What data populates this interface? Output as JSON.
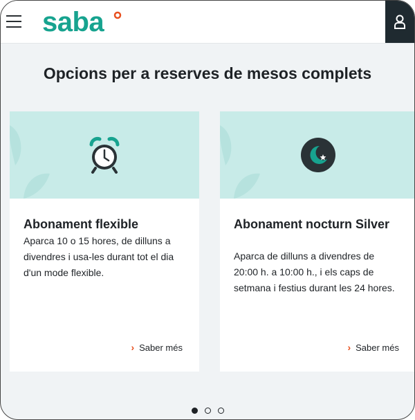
{
  "header": {
    "logo_text": "saba",
    "brand_color": "#17a38f",
    "accent_color": "#e8501f",
    "menu_icon": "hamburger-icon",
    "account_icon": "user-icon"
  },
  "page": {
    "title": "Opcions per a reserves de mesos complets"
  },
  "cards": [
    {
      "icon": "alarm-clock-icon",
      "title": "Abonament flexible",
      "description": "Aparca 10 o 15 hores, de dilluns a divendres i usa-les durant tot el dia d'un mode flexible.",
      "link_label": "Saber més"
    },
    {
      "icon": "moon-star-icon",
      "title": "Abonament nocturn Silver",
      "description": "Aparca de dilluns a divendres de 20:00 h. a 10:00 h., i els caps de setmana i festius durant les 24 hores.",
      "link_label": "Saber més"
    }
  ],
  "carousel": {
    "pages": 3,
    "active_index": 0
  }
}
